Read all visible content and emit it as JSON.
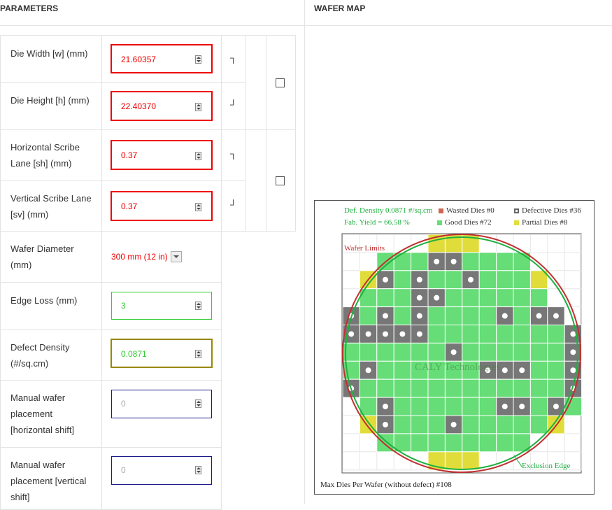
{
  "headers": {
    "parameters": "PARAMETERS",
    "wafer_map": "WAFER MAP"
  },
  "params": {
    "die_width": {
      "label": "Die Width [w] (mm)",
      "value": "21.60357"
    },
    "die_height": {
      "label": "Die Height [h] (mm)",
      "value": "22.40370"
    },
    "h_scribe": {
      "label1": "Horizontal Scribe",
      "label2": "Lane [sh] (mm)",
      "value": "0.37"
    },
    "v_scribe": {
      "label1": "Vertical Scribe Lane",
      "label2": "[sv] (mm)",
      "value": "0.37"
    },
    "wafer_diameter": {
      "label1": "Wafer Diameter",
      "label2": "(mm)",
      "value": "300 mm (12 in)"
    },
    "edge_loss": {
      "label": "Edge Loss (mm)",
      "value": "3"
    },
    "defect_density": {
      "label1": "Defect Density",
      "label2": "(#/sq.cm)",
      "value": "0.0871"
    },
    "manual_h": {
      "label1": "Manual wafer",
      "label2": "placement",
      "label3": "[horizontal shift]",
      "placeholder": "0"
    },
    "manual_v": {
      "label1": "Manual wafer",
      "label2": "placement [vertical",
      "label3": "shift]",
      "placeholder": "0"
    },
    "bracket_top": "┐",
    "bracket_bottom": "┘"
  },
  "map": {
    "def_density": "Def. Density 0.0871 #/sq.cm",
    "fab_yield": "Fab. Yield = 66.58 %",
    "wasted": "Wasted Dies  #0",
    "defective": "Defective Dies  #36",
    "good": "Good Dies #72",
    "partial": "Partial Dies #8",
    "wafer_limits": "Wafer Limits",
    "exclusion_edge": "Exclusion Edge",
    "watermark": "CALY Technologies",
    "footer": "Max Dies Per Wafer (without defect) #108"
  },
  "colors": {
    "good": "#66dd77",
    "defective": "#777777",
    "partial": "#e0dd3a",
    "wasted": "#cc6655",
    "limit": "#c03030",
    "exclusion": "#20b040",
    "error_border": "#ee0000",
    "ok_border": "#33cc33",
    "warn_border": "#998800",
    "manual_border": "#1a1a8a"
  },
  "die_rows": [
    "..PPP..",
    "..GGGDDGGGG..",
    "..PDGDGGDGGGP..",
    "..GGGDDGGGGGG..",
    ".DGDGDGGGGDGDD.",
    ".DDDDDGGGGGGGGD.",
    ".GGGGGGDGGGGGGD.",
    ".GDGGGGGGDDDGGD.",
    ".DGGGGGGGGGGGGD.",
    "..GDGGGGGGDDGDG.",
    "..PDGGGDGGGGGP..",
    "...GGGGGGGGG...",
    "......PPP......"
  ]
}
